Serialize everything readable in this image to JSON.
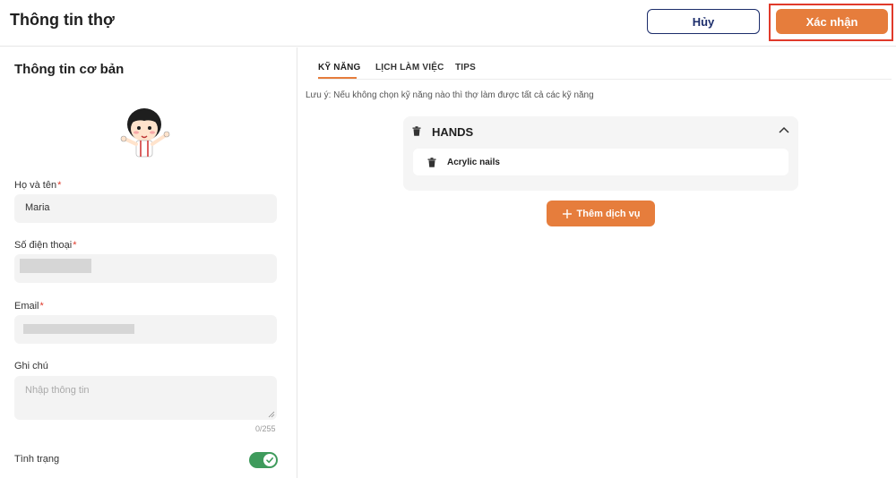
{
  "header": {
    "title": "Thông tin thợ",
    "cancel_label": "Hủy",
    "confirm_label": "Xác nhận"
  },
  "basic_info": {
    "title": "Thông tin cơ bản",
    "name": {
      "label": "Họ và tên",
      "value": "Maria"
    },
    "phone": {
      "label": "Số điện thoại",
      "value": ""
    },
    "email": {
      "label": "Email",
      "value": ""
    },
    "notes": {
      "label": "Ghi chú",
      "placeholder": "Nhập thông tin",
      "counter": "0/255"
    },
    "status": {
      "label": "Tình trạng",
      "enabled": true
    }
  },
  "tabs": [
    {
      "label": "KỸ NĂNG",
      "active": true
    },
    {
      "label": "LỊCH LÀM VIỆC",
      "active": false
    },
    {
      "label": "TIPS",
      "active": false
    }
  ],
  "skills": {
    "note": "Lưu ý: Nếu không chọn kỹ năng nào thì thợ làm được tất cả các kỹ năng",
    "groups": [
      {
        "name": "HANDS",
        "items": [
          "Acrylic nails"
        ]
      }
    ],
    "add_label": "Thêm dịch vụ"
  },
  "colors": {
    "accent": "#e67d3c",
    "navy": "#1c2d6b",
    "toggle_on": "#3f9b5c",
    "highlight": "#e03a2b"
  }
}
